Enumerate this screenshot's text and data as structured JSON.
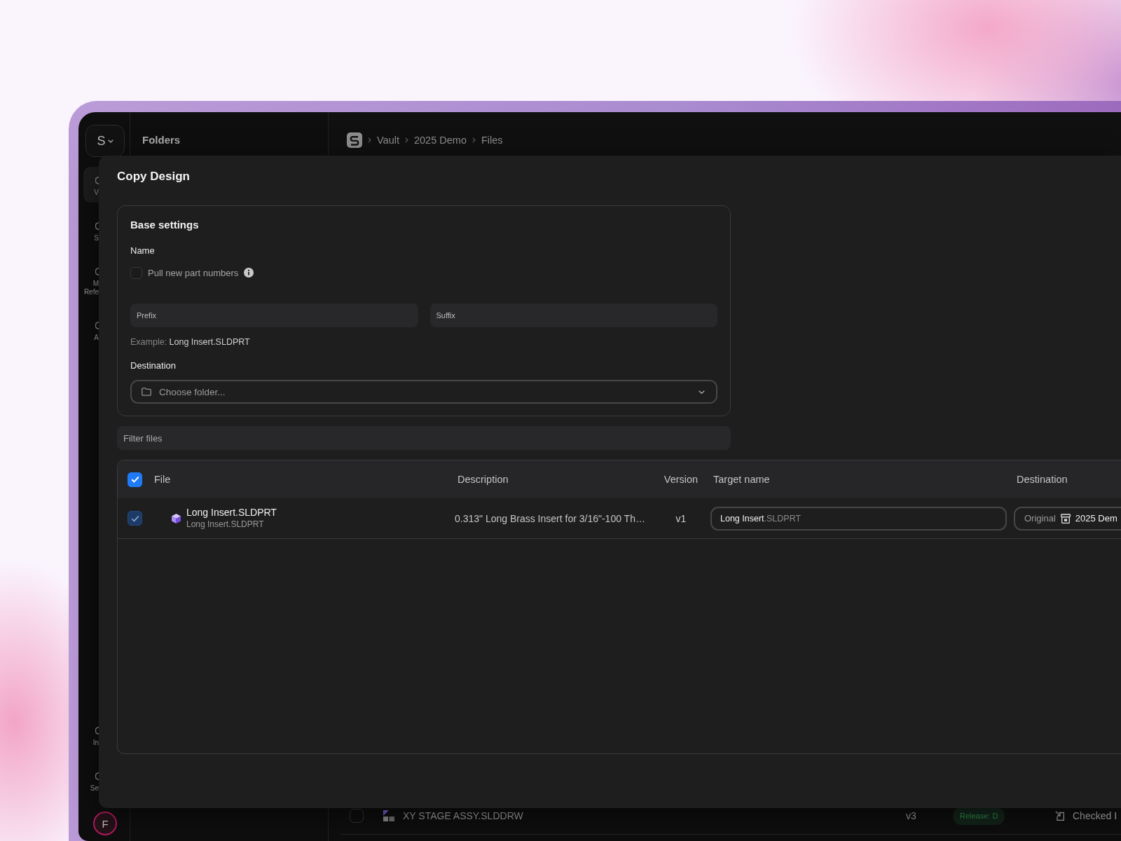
{
  "sidebar": {
    "workspace": {
      "letter": "S"
    },
    "items": [
      {
        "lines": [
          "V"
        ],
        "selected": true
      },
      {
        "lines": [
          "S"
        ],
        "selected": false
      },
      {
        "lines": [
          "M",
          "Refe"
        ],
        "selected": false
      },
      {
        "lines": [
          "A"
        ],
        "selected": false
      }
    ],
    "bottom_items": [
      {
        "lines": [
          "In"
        ],
        "selected": false
      },
      {
        "lines": [
          "Se"
        ],
        "selected": false
      }
    ],
    "avatar": {
      "initial": "F"
    }
  },
  "folders_panel": {
    "title": "Folders"
  },
  "breadcrumb": [
    "Vault",
    "2025 Demo",
    "Files"
  ],
  "file_list": {
    "rows": [
      {
        "checked": false,
        "name": "XY STAGE ASSY.SLDDRW",
        "version": "v3",
        "state": "Release: D",
        "status": "Checked I"
      }
    ]
  },
  "dialog": {
    "title": "Copy Design",
    "base_settings": {
      "title": "Base settings",
      "name_label": "Name",
      "pull_part_numbers": {
        "label": "Pull new part numbers",
        "checked": false
      },
      "prefix": {
        "placeholder": "Prefix"
      },
      "suffix": {
        "placeholder": "Suffix"
      },
      "example": {
        "label": "Example:",
        "value": "Long Insert.SLDPRT"
      },
      "destination_label": "Destination",
      "destination": {
        "placeholder": "Choose folder..."
      }
    },
    "filter": {
      "placeholder": "Filter files"
    },
    "table": {
      "all_checked": true,
      "columns": [
        "File",
        "Description",
        "Version",
        "Target name",
        "Destination"
      ],
      "rows": [
        {
          "checked": true,
          "disabled": true,
          "name": "Long Insert.SLDPRT",
          "subname": "Long Insert.SLDPRT",
          "description": "0.313\" Long Brass Insert for 3/16\"-100 Th…",
          "version": "v1",
          "target_name": {
            "base": "Long Insert",
            "extension": ".SLDPRT"
          },
          "destination": {
            "mode": "Original",
            "folder": "2025 Dem"
          }
        }
      ]
    }
  }
}
